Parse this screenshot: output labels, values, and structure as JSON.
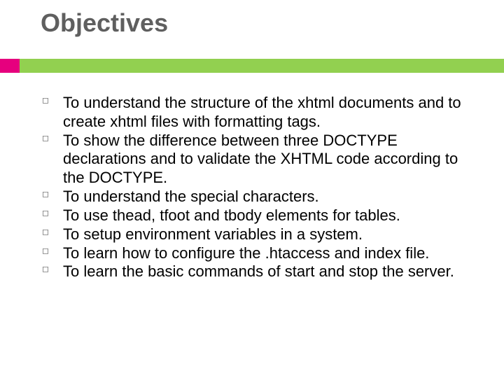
{
  "title": "Objectives",
  "bullets": {
    "b0": "To understand the structure of the xhtml documents and to create xhtml files with formatting tags.",
    "b1": "To show the difference between three DOCTYPE declarations and to validate the XHTML code according to the DOCTYPE.",
    "b2": "To understand the special characters.",
    "b3": "To use thead, tfoot and tbody elements for tables.",
    "b4": "To setup environment variables in a system.",
    "b5": "To learn how to configure the .htaccess and index file.",
    "b6": "To learn the basic commands of start and stop the server."
  },
  "colors": {
    "accent_pink": "#e6007e",
    "accent_green": "#92d050",
    "title_gray": "#5f5f5f"
  }
}
